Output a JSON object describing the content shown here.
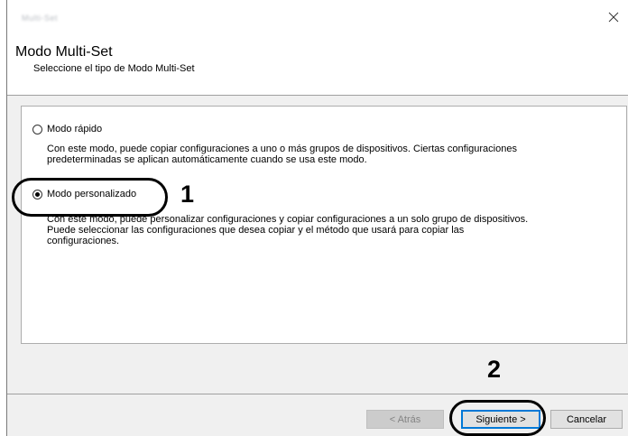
{
  "window": {
    "title": "Multi-Set",
    "close_glyph": "✕"
  },
  "header": {
    "title": "Modo Multi-Set",
    "subtitle": "Seleccione el tipo de Modo Multi-Set"
  },
  "options": [
    {
      "label": "Modo rápido",
      "selected": false,
      "description_line1": "Con este modo, puede copiar configuraciones a uno o más grupos de dispositivos. Ciertas configuraciones",
      "description_line2": "predeterminadas se aplican automáticamente cuando se usa este modo."
    },
    {
      "label": "Modo personalizado",
      "selected": true,
      "description_line1": "Con este modo, puede personalizar configuraciones y copiar configuraciones a un solo grupo de dispositivos.",
      "description_line2": "Puede seleccionar las configuraciones que desea copiar y el método que usará para copiar las",
      "description_line3": "configuraciones."
    }
  ],
  "callouts": {
    "first": "1",
    "second": "2"
  },
  "buttons": {
    "back": "< Atrás",
    "next": "Siguiente >",
    "cancel": "Cancelar"
  },
  "colors": {
    "focus_border": "#0078d7",
    "dialog_background": "#f0f0f0",
    "header_background": "#ffffff"
  },
  "icons": {
    "close": "close-icon"
  }
}
